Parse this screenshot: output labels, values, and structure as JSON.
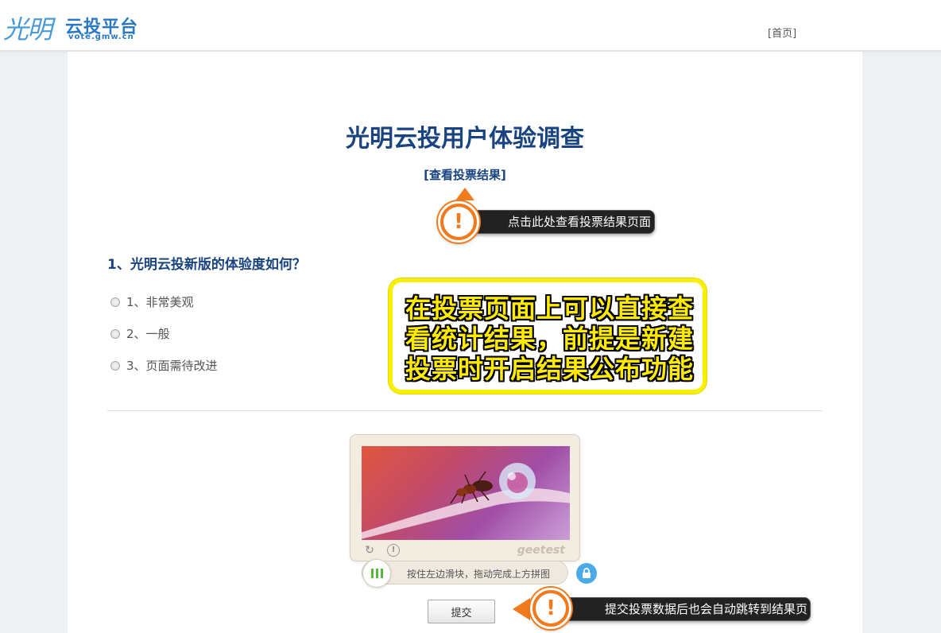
{
  "header": {
    "logo_script": "光明",
    "logo_name": "云投平台",
    "logo_url": "vote.gmw.cn",
    "nav_home": "[首页]"
  },
  "survey": {
    "title": "光明云投用户体验调查",
    "results_link": "[查看投票结果]",
    "question": "1、光明云投新版的体验度如何？",
    "options": [
      "1、非常美观",
      "2、一般",
      "3、页面需待改进"
    ]
  },
  "captcha": {
    "brand": "geetest",
    "slider_text": "按住左边滑块，拖动完成上方拼图",
    "icons": [
      "refresh-icon",
      "info-icon",
      "slider-grip-icon",
      "lock-icon"
    ]
  },
  "submit_label": "提交",
  "annotations": {
    "results_callout": "点击此处查看投票结果页面",
    "submit_callout": "提交投票数据后也会自动跳转到结果页",
    "note_lines": [
      "在投票页面上可以直接查",
      "看统计结果，前提是新建",
      "投票时开启结果公布功能"
    ]
  },
  "colors": {
    "title": "#1a4480",
    "accent_orange": "#f07a1c",
    "note_yellow": "#ffeb00",
    "slider_green": "#58b83a",
    "lock_blue": "#4aabe8"
  }
}
